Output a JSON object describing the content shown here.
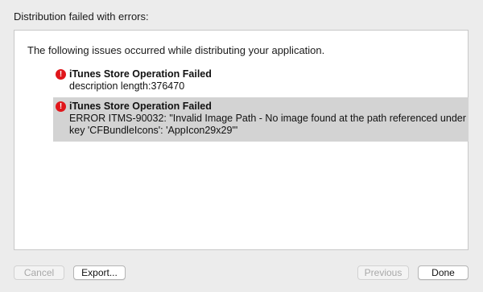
{
  "dialog": {
    "header": "Distribution failed with errors:",
    "intro": "The following issues occurred while distributing your application."
  },
  "issues": [
    {
      "icon": "error-icon",
      "title": "iTunes Store Operation Failed",
      "detail": "description length:376470"
    },
    {
      "icon": "error-icon",
      "title": "iTunes Store Operation Failed",
      "detail": "ERROR ITMS-90032: \"Invalid Image Path - No image found at the path referenced under key 'CFBundleIcons': 'AppIcon29x29'\""
    }
  ],
  "buttons": {
    "cancel": "Cancel",
    "export": "Export...",
    "previous": "Previous",
    "done": "Done"
  },
  "colors": {
    "error": "#e0161b",
    "selected_row": "#d3d3d3",
    "window_bg": "#ececec"
  }
}
